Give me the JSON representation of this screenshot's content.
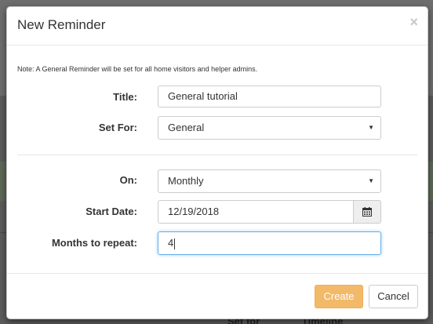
{
  "modal": {
    "title": "New Reminder",
    "close_symbol": "×",
    "note": "Note: A General Reminder will be set for all home visitors and helper admins.",
    "fields": {
      "title": {
        "label": "Title:",
        "value": "General tutorial"
      },
      "set_for": {
        "label": "Set For:",
        "value": "General"
      },
      "on": {
        "label": "On:",
        "value": "Monthly"
      },
      "start_date": {
        "label": "Start Date:",
        "value": "12/19/2018"
      },
      "months_to_repeat": {
        "label": "Months to repeat:",
        "value": "4"
      }
    },
    "buttons": {
      "create": "Create",
      "cancel": "Cancel"
    }
  },
  "background": {
    "table_headers": [
      "Set for",
      "Timeline"
    ]
  },
  "colors": {
    "create_button": "#f0ad4e",
    "focus_border": "#66afe9",
    "overlay": "#5c5c5c"
  },
  "icons": {
    "date_picker": "calendar-icon",
    "close": "close-icon",
    "select_arrow": "chevron-down-icon"
  }
}
